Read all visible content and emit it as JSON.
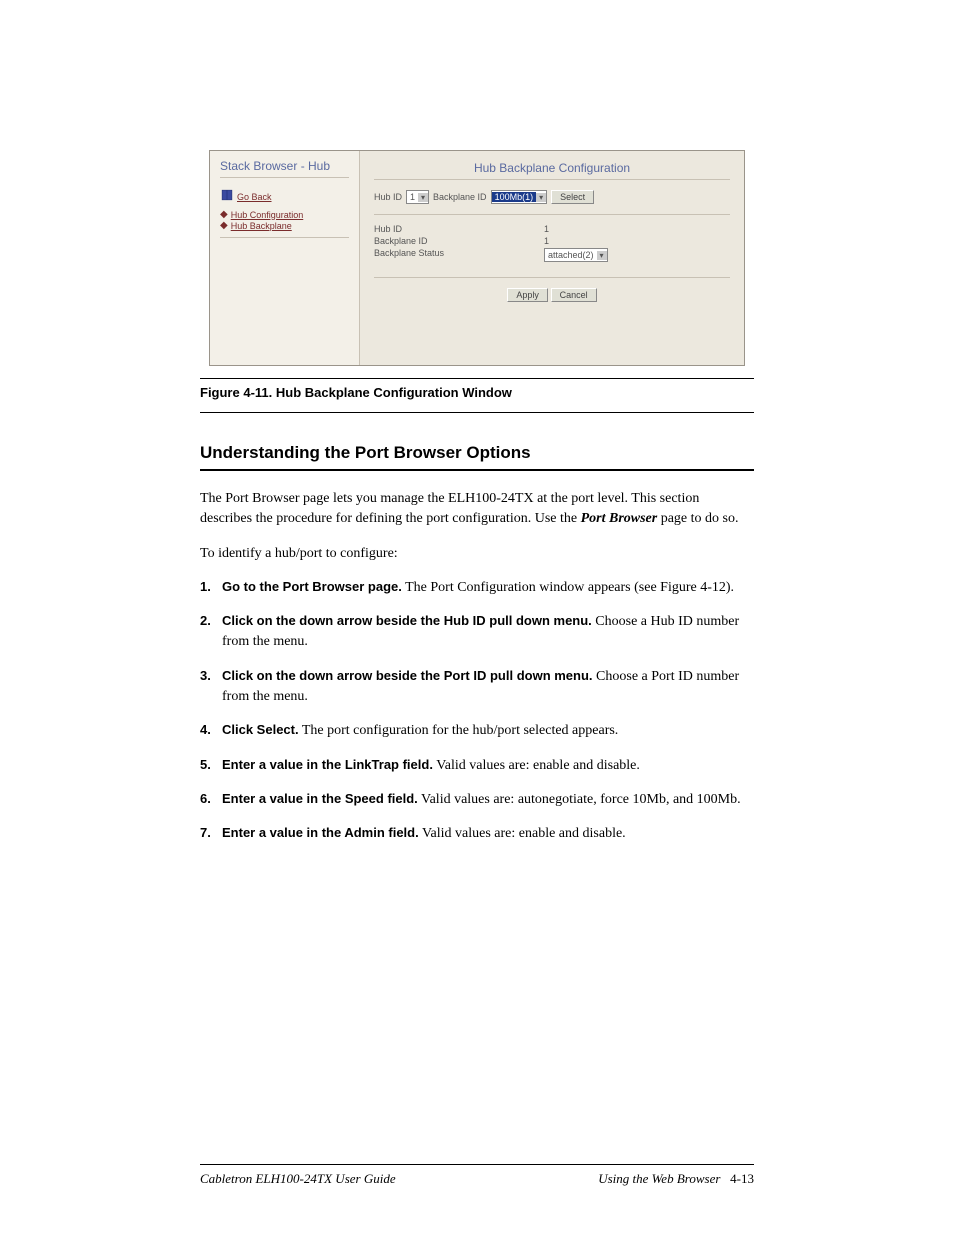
{
  "screenshot": {
    "left": {
      "title": "Stack Browser - Hub",
      "back": "Go Back",
      "link1": "Hub Configuration",
      "link2": "Hub Backplane"
    },
    "right": {
      "title": "Hub Backplane Configuration",
      "hubid_label": "Hub ID",
      "hubid_value": "1",
      "bpid_label": "Backplane ID",
      "bpid_value": "100Mb(1)",
      "select_btn": "Select",
      "row1_label": "Hub ID",
      "row1_value": "1",
      "row2_label": "Backplane ID",
      "row2_value": "1",
      "row3_label": "Backplane Status",
      "row3_value": "attached(2)",
      "apply_btn": "Apply",
      "cancel_btn": "Cancel"
    }
  },
  "figcaption": "Figure 4-11. Hub Backplane Configuration Window",
  "section_title": "Understanding the Port Browser Options",
  "para1_a": "The Port Browser page lets you manage the ELH100-24TX at the port level. This section describes the procedure for defining the port configuration. Use the ",
  "para1_b": "Port Browser",
  "para1_c": " page to do so.",
  "para2": "To identify a hub/port to configure:",
  "step1_lead": "Go to the Port Browser page.",
  "step1_rest": " The Port Configuration window appears (see Figure 4-12).",
  "step2_lead": "Click on the down arrow beside the Hub ID pull down menu.",
  "step2_rest": " Choose a Hub ID number from the menu.",
  "step3_lead": "Click on the down arrow beside the Port ID pull down menu.",
  "step3_rest": " Choose a Port ID number from the menu.",
  "step4_lead": "Click Select.",
  "step4_rest": " The port configuration for the hub/port selected appears.",
  "step5_lead": "Enter a value in the LinkTrap field.",
  "step5_rest": " Valid values are: enable and disable.",
  "step6_lead": "Enter a value in the Speed field.",
  "step6_rest": " Valid values are: autonegotiate, force 10Mb, and 100Mb.",
  "step7_lead": "Enter a value in the Admin field.",
  "step7_rest": " Valid values are: enable and disable.",
  "footer_left": "Cabletron ELH100-24TX User Guide",
  "footer_right": "Using the Web Browser",
  "footer_page": "4-13"
}
